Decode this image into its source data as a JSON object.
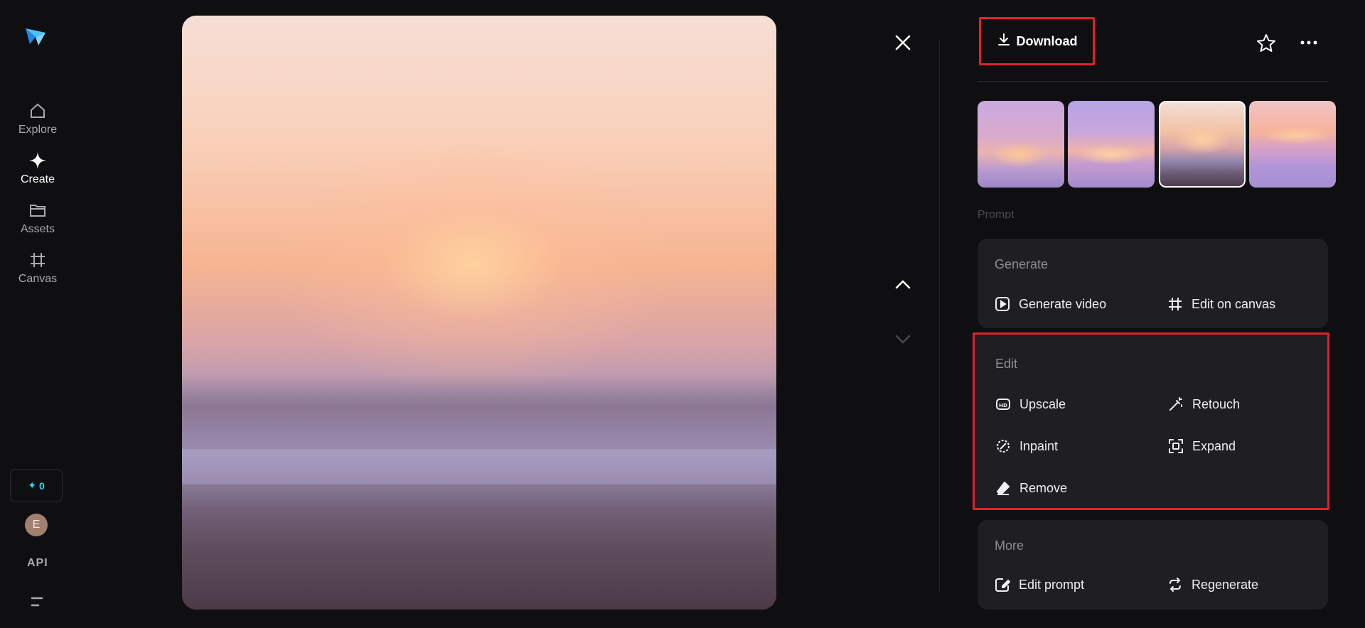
{
  "nav": {
    "items": [
      {
        "label": "Explore",
        "icon": "home-icon"
      },
      {
        "label": "Create",
        "icon": "sparkle-icon"
      },
      {
        "label": "Assets",
        "icon": "folder-icon"
      },
      {
        "label": "Canvas",
        "icon": "canvas-frame-icon"
      }
    ],
    "credits": "0",
    "avatar_letter": "E",
    "api_label": "API"
  },
  "toolbar": {
    "download_label": "Download"
  },
  "prompt_label": "Prompt",
  "generate": {
    "title": "Generate",
    "actions": [
      {
        "label": "Generate video",
        "icon": "play-square-icon"
      },
      {
        "label": "Edit on canvas",
        "icon": "canvas-frame-icon"
      }
    ]
  },
  "edit": {
    "title": "Edit",
    "actions": [
      {
        "label": "Upscale",
        "icon": "hd-icon"
      },
      {
        "label": "Retouch",
        "icon": "magic-wand-icon"
      },
      {
        "label": "Inpaint",
        "icon": "inpaint-brush-icon"
      },
      {
        "label": "Expand",
        "icon": "expand-icon"
      },
      {
        "label": "Remove",
        "icon": "eraser-icon"
      }
    ]
  },
  "more": {
    "title": "More",
    "actions": [
      {
        "label": "Edit prompt",
        "icon": "edit-prompt-icon"
      },
      {
        "label": "Regenerate",
        "icon": "regenerate-icon"
      }
    ]
  },
  "colors": {
    "accent_highlight": "#e0212b",
    "credit_cyan": "#2fd6ff",
    "card_bg": "#1e1e23",
    "page_bg": "#0f0f11"
  }
}
